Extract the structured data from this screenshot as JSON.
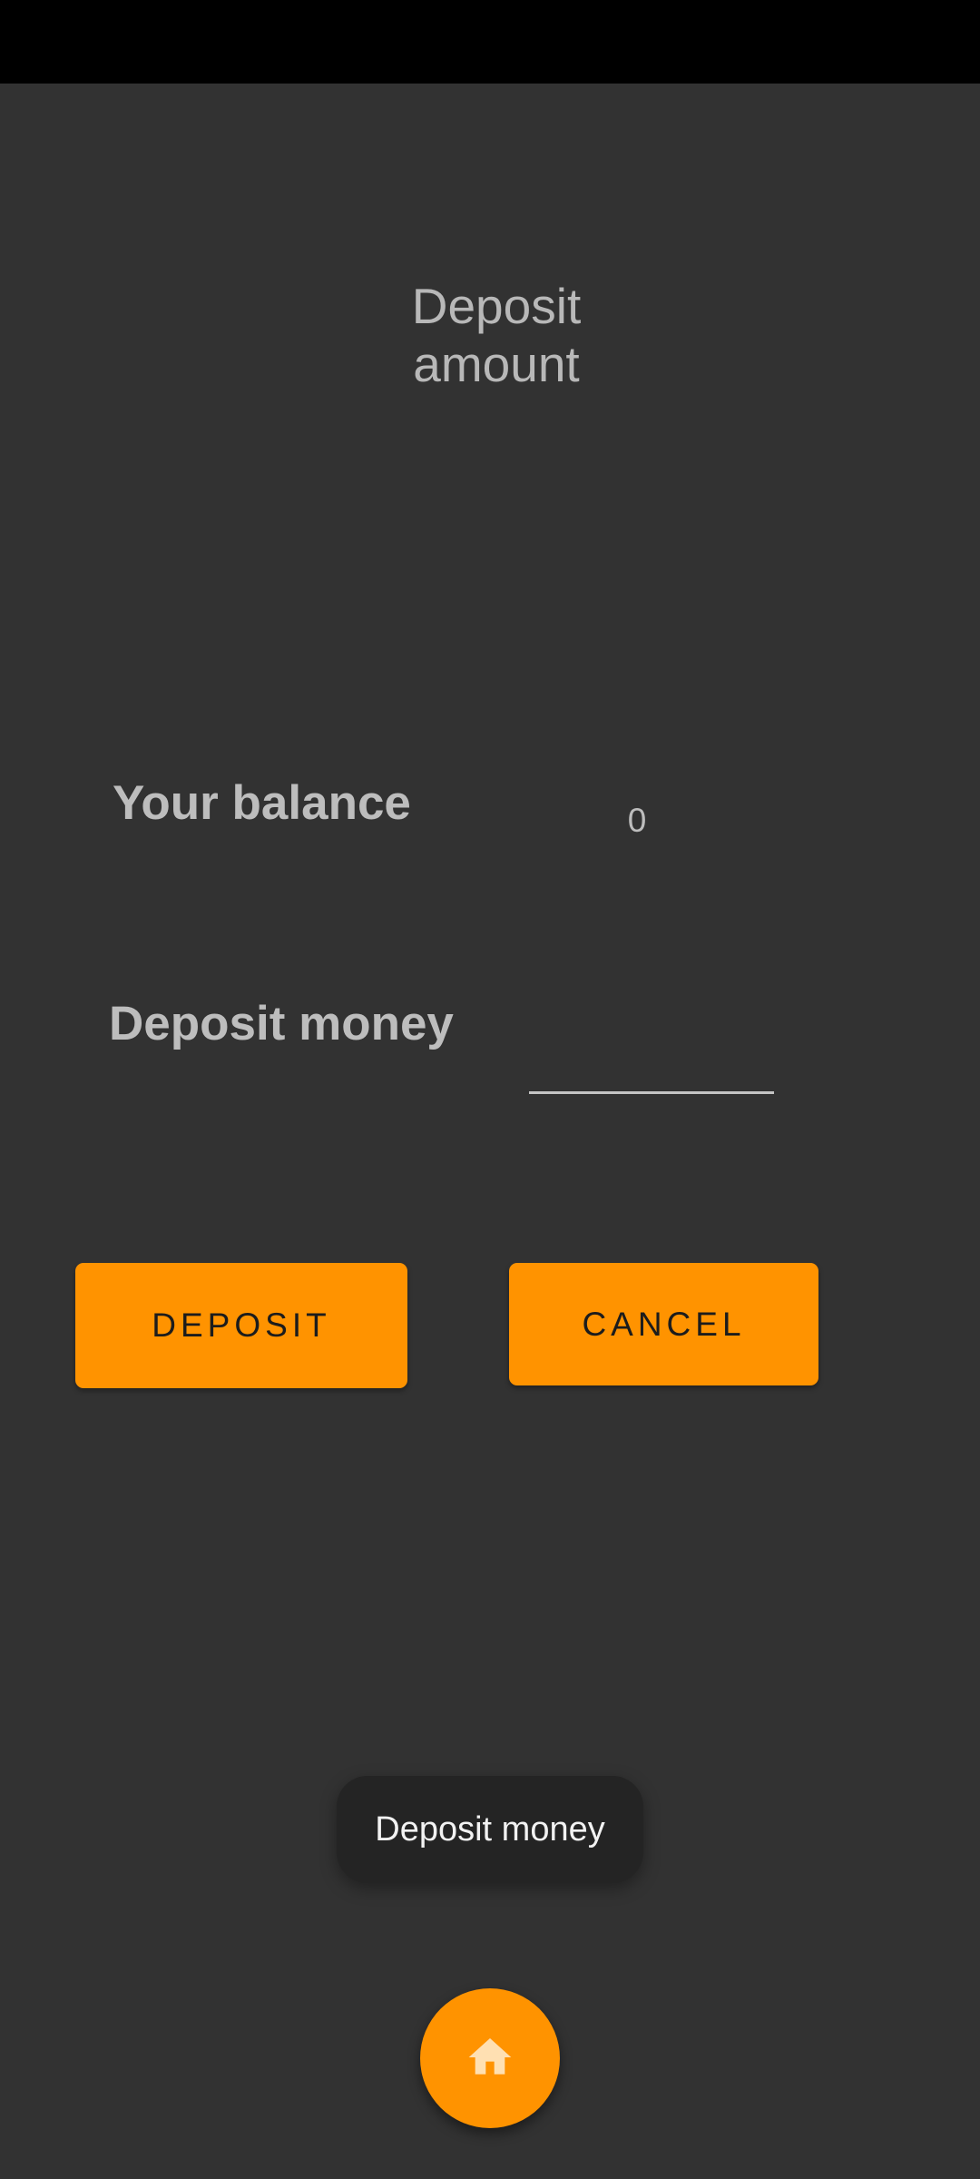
{
  "header": {
    "title_line1": "Deposit",
    "title_line2": "amount"
  },
  "balance": {
    "label": "Your balance",
    "value": "0"
  },
  "deposit_field": {
    "label": "Deposit money",
    "value": "",
    "placeholder": ""
  },
  "buttons": {
    "deposit_label": "DEPOSIT",
    "cancel_label": "CANCEL"
  },
  "toast": {
    "text": "Deposit money"
  },
  "fab": {
    "icon": "home-icon"
  },
  "colors": {
    "background": "#323232",
    "accent": "#ff9300",
    "status_bar": "#000000",
    "text_muted": "#bdbdbd"
  }
}
